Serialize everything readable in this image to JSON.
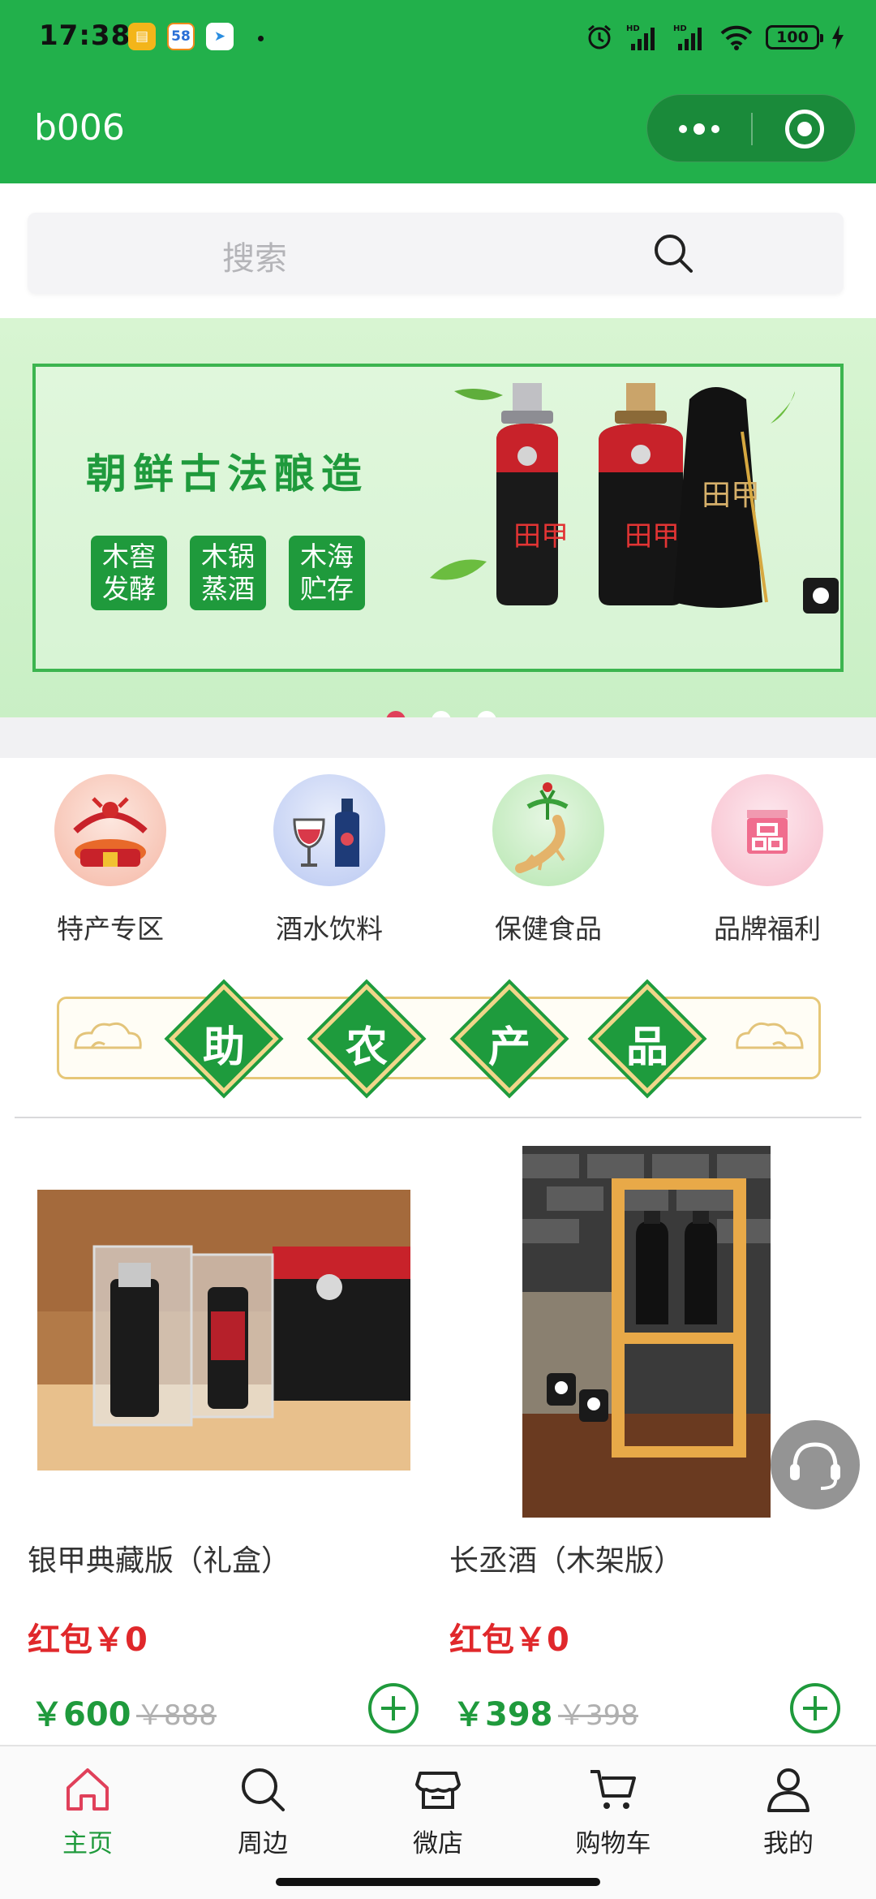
{
  "status_bar": {
    "time": "17:38",
    "app_badge": "58",
    "battery": "100",
    "icons": [
      "notes-app-icon",
      "58-app-icon",
      "telegram-icon",
      "alarm-icon",
      "signal-hd-icon",
      "signal-hd-icon",
      "wifi-icon",
      "battery-icon",
      "charging-icon"
    ]
  },
  "nav": {
    "title": "b006"
  },
  "search": {
    "placeholder": "搜索"
  },
  "banner": {
    "headline": "朝鲜古法酿造",
    "tags": [
      {
        "line1": "木窖",
        "line2": "发酵"
      },
      {
        "line1": "木锅",
        "line2": "蒸酒"
      },
      {
        "line1": "木海",
        "line2": "贮存"
      }
    ],
    "bottle_text": "田甲",
    "active_slide": 0,
    "slide_count": 3,
    "colors": {
      "accent": "#1f9a3c",
      "dot_active": "#e0405a",
      "dot_inactive": "#ffffff"
    }
  },
  "categories": [
    {
      "label": "特产专区",
      "icon": "gift-basket-icon"
    },
    {
      "label": "酒水饮料",
      "icon": "wine-bottle-icon"
    },
    {
      "label": "保健食品",
      "icon": "ginseng-icon"
    },
    {
      "label": "品牌福利",
      "icon": "brand-box-icon"
    }
  ],
  "farm_banner": {
    "chars": [
      "助",
      "农",
      "产",
      "品"
    ]
  },
  "products": [
    {
      "name": "银甲典藏版（礼盒）",
      "red_packet": "红包￥0",
      "price": "￥600",
      "original_price": "￥888"
    },
    {
      "name": "长丞酒（木架版）",
      "red_packet": "红包￥0",
      "price": "￥398",
      "original_price": "￥398"
    }
  ],
  "tabbar": [
    {
      "label": "主页",
      "icon": "home-icon",
      "active": true
    },
    {
      "label": "周边",
      "icon": "search-icon",
      "active": false
    },
    {
      "label": "微店",
      "icon": "shop-icon",
      "active": false
    },
    {
      "label": "购物车",
      "icon": "cart-icon",
      "active": false
    },
    {
      "label": "我的",
      "icon": "user-icon",
      "active": false
    }
  ],
  "colors": {
    "brand_green": "#22b04b",
    "price_red": "#e0282b",
    "price_green": "#1f9a3c"
  }
}
